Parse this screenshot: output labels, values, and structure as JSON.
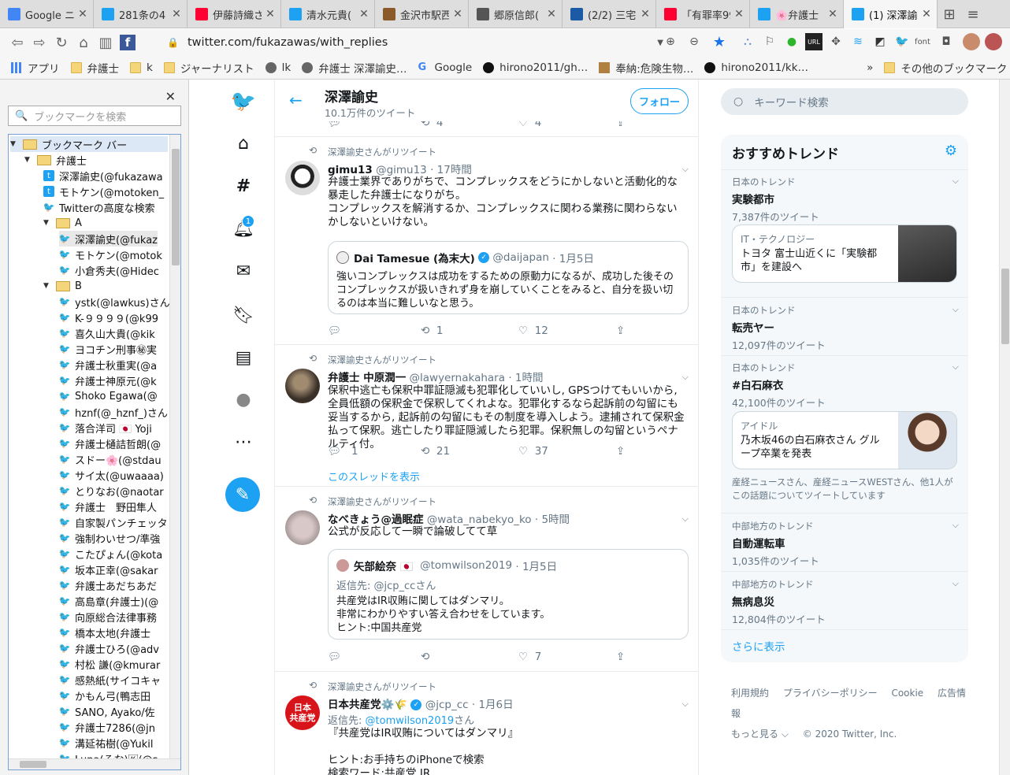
{
  "tabs": [
    {
      "title": "Google ニ",
      "icon": "google-news-icon",
      "color": "#4285f4"
    },
    {
      "title": "281条の4",
      "icon": "twitter-icon",
      "color": "#1da1f2"
    },
    {
      "title": "伊藤詩織さ",
      "icon": "yahoo-icon",
      "color": "#ff0033"
    },
    {
      "title": "清水元貴(",
      "icon": "twitter-icon",
      "color": "#1da1f2"
    },
    {
      "title": "金沢市駅西",
      "icon": "site-icon",
      "color": "#8a5a2b"
    },
    {
      "title": "郷原信郎(",
      "icon": "site-icon",
      "color": "#555555"
    },
    {
      "title": "(2/2) 三宅",
      "icon": "j-icon",
      "color": "#1d5aa6"
    },
    {
      "title": "「有罪率99",
      "icon": "yahoo-icon",
      "color": "#ff0033"
    },
    {
      "title": "🌸弁護士",
      "icon": "twitter-icon",
      "color": "#1da1f2"
    },
    {
      "title": "(1) 深澤諭",
      "icon": "twitter-icon",
      "color": "#1da1f2"
    }
  ],
  "toolbar": {
    "url": "twitter.com/fukazawas/with_replies"
  },
  "bookmarks_bar": [
    "アプリ",
    "弁護士",
    "k",
    "ジャーナリスト",
    "lk",
    "弁護士 深澤諭史…",
    "Google",
    "hirono2011/gh…",
    "奉納:危険生物…",
    "hirono2011/kk…",
    "»",
    "その他のブックマーク"
  ],
  "sidebar": {
    "search_placeholder": "ブックマークを検索",
    "tree": [
      {
        "label": "ブックマーク バー",
        "type": "folder",
        "level": 0,
        "open": true
      },
      {
        "label": "弁護士",
        "type": "folder",
        "level": 1,
        "open": true
      },
      {
        "label": "深澤諭史(@fukazawa",
        "type": "bm",
        "level": 2,
        "icon": "t"
      },
      {
        "label": "モトケン(@motoken_",
        "type": "bm",
        "level": 2,
        "icon": "t"
      },
      {
        "label": "Twitterの高度な検索",
        "type": "bm",
        "level": 2,
        "icon": "tw"
      },
      {
        "label": "A",
        "type": "folder",
        "level": 2,
        "open": true
      },
      {
        "label": "深澤諭史(@fukaz",
        "type": "bm",
        "level": 3,
        "icon": "tw",
        "selected": true
      },
      {
        "label": "モトケン(@motok",
        "type": "bm",
        "level": 3,
        "icon": "tw"
      },
      {
        "label": "小倉秀夫(@Hidec",
        "type": "bm",
        "level": 3,
        "icon": "tw"
      },
      {
        "label": "B",
        "type": "folder",
        "level": 2,
        "open": true
      },
      {
        "label": "ystk(@lawkus)さん",
        "type": "bm",
        "level": 3,
        "icon": "tw"
      },
      {
        "label": "K-９９９９(@k99",
        "type": "bm",
        "level": 3,
        "icon": "tw"
      },
      {
        "label": "喜久山大貴(@kik",
        "type": "bm",
        "level": 3,
        "icon": "tw"
      },
      {
        "label": "ヨコチン刑事㊙実",
        "type": "bm",
        "level": 3,
        "icon": "tw"
      },
      {
        "label": "弁護士秋重実(@a",
        "type": "bm",
        "level": 3,
        "icon": "tw"
      },
      {
        "label": "弁護士神原元(@k",
        "type": "bm",
        "level": 3,
        "icon": "tw"
      },
      {
        "label": "Shoko Egawa(@",
        "type": "bm",
        "level": 3,
        "icon": "tw"
      },
      {
        "label": "hznf(@_hznf_)さん",
        "type": "bm",
        "level": 3,
        "icon": "tw"
      },
      {
        "label": "落合洋司 🇯🇵 Yoji",
        "type": "bm",
        "level": 3,
        "icon": "tw"
      },
      {
        "label": "弁護士樋詰哲朗(@",
        "type": "bm",
        "level": 3,
        "icon": "tw"
      },
      {
        "label": "スドー🌸(@stdau",
        "type": "bm",
        "level": 3,
        "icon": "tw"
      },
      {
        "label": "サイ太(@uwaaaa)",
        "type": "bm",
        "level": 3,
        "icon": "tw"
      },
      {
        "label": "とりなお(@naotar",
        "type": "bm",
        "level": 3,
        "icon": "tw"
      },
      {
        "label": "弁護士　野田隼人",
        "type": "bm",
        "level": 3,
        "icon": "tw"
      },
      {
        "label": "自家製パンチェッタ",
        "type": "bm",
        "level": 3,
        "icon": "tw"
      },
      {
        "label": "強制わいせつ/準強",
        "type": "bm",
        "level": 3,
        "icon": "tw"
      },
      {
        "label": "こたぴょん(@kota",
        "type": "bm",
        "level": 3,
        "icon": "tw"
      },
      {
        "label": "坂本正幸(@sakar",
        "type": "bm",
        "level": 3,
        "icon": "tw"
      },
      {
        "label": "弁護士あだちあだ",
        "type": "bm",
        "level": 3,
        "icon": "tw"
      },
      {
        "label": "高島章(弁護士)(@",
        "type": "bm",
        "level": 3,
        "icon": "tw"
      },
      {
        "label": "向原総合法律事務",
        "type": "bm",
        "level": 3,
        "icon": "tw"
      },
      {
        "label": "橋本太地(弁護士",
        "type": "bm",
        "level": 3,
        "icon": "tw"
      },
      {
        "label": "弁護士ひろ(@adv",
        "type": "bm",
        "level": 3,
        "icon": "tw"
      },
      {
        "label": "村松 謙(@kmurar",
        "type": "bm",
        "level": 3,
        "icon": "tw"
      },
      {
        "label": "感熱紙(サイコキャ",
        "type": "bm",
        "level": 3,
        "icon": "tw"
      },
      {
        "label": "かもん弓(鴨志田",
        "type": "bm",
        "level": 3,
        "icon": "tw"
      },
      {
        "label": "SANO, Ayako/佐",
        "type": "bm",
        "level": 3,
        "icon": "tw"
      },
      {
        "label": "弁護士7286(@jn",
        "type": "bm",
        "level": 3,
        "icon": "tw"
      },
      {
        "label": "溝延祐樹(@Yukil",
        "type": "bm",
        "level": 3,
        "icon": "tw"
      },
      {
        "label": "Luna(るな)🄺(@s",
        "type": "bm",
        "level": 3,
        "icon": "tw"
      }
    ]
  },
  "nav": {
    "notification_count": "1"
  },
  "profile": {
    "name": "深澤諭史",
    "tweet_count": "10.1万件のツイート",
    "follow_label": "フォロー"
  },
  "top_partial": {
    "retweets": "4",
    "likes": "4"
  },
  "tweets": [
    {
      "retweet_label": "深澤諭史さんがリツイート",
      "name": "gimu13",
      "handle": "@gimu13",
      "time": "· 17時間",
      "text": "弁護士業界でありがちで、コンプレックスをどうにかしないと活動化的な暴走した弁護士になりがち。\nコンプレックスを解消するか、コンプレックスに関わる業務に関わらないかしないといけない。",
      "quote": {
        "name": "Dai Tamesue (為末大)",
        "handle": "@daijapan",
        "time": "· 1月5日",
        "text": "強いコンプレックスは成功をするための原動力になるが、成功した後そのコンプレックスが扱いきれず身を崩していくことをみると、自分を扱い切るのは本当に難しいなと思う。"
      },
      "replies": "",
      "retweets": "1",
      "likes": "12"
    },
    {
      "retweet_label": "深澤諭史さんがリツイート",
      "name": "弁護士 中原潤一",
      "handle": "@lawyernakahara",
      "time": "· 1時間",
      "text": "保釈中逃亡も保釈中罪証隠滅も犯罪化していいし, GPSつけてもいいから, 全員低額の保釈金で保釈してくれよな。犯罪化するなら起訴前の勾留にも妥当するから, 起訴前の勾留にもその制度を導入しよう。逮捕されて保釈金払って保釈。逃亡したり罪証隠滅したら犯罪。保釈無しの勾留というペナルティ付。",
      "replies": "1",
      "retweets": "21",
      "likes": "37",
      "thread_label": "このスレッドを表示"
    },
    {
      "retweet_label": "深澤諭史さんがリツイート",
      "name": "なべきょう@過眠症",
      "handle": "@wata_nabekyo_ko",
      "time": "· 5時間",
      "text": "公式が反応して一瞬で論破してて草",
      "quote": {
        "name": "矢部絵奈 🇯🇵",
        "handle": "@tomwilson2019",
        "time": "· 1月5日",
        "reply_to": "返信先: @jcp_ccさん",
        "text": "共産党はIR収賄に関してはダンマリ。\n非常にわかりやすい答え合わせをしています。\nヒント:中国共産党"
      },
      "replies": "",
      "retweets": "",
      "likes": "7"
    },
    {
      "retweet_label": "深澤諭史さんがリツイート",
      "name": "日本共産党⚙️🌾",
      "handle": "@jcp_cc",
      "time": "· 1月6日",
      "reply_to_prefix": "返信先: ",
      "reply_to_handle": "@tomwilson2019",
      "reply_to_suffix": "さん",
      "text": "『共産党はIR収賄についてはダンマリ』\n\nヒント:お手持ちのiPhoneで検索\n検索ワード:共産党 IR"
    }
  ],
  "right": {
    "search_placeholder": "キーワード検索",
    "trends_title": "おすすめトレンド",
    "trends": [
      {
        "category": "日本のトレンド",
        "name": "実験都市",
        "count": "7,387件のツイート"
      },
      {
        "card": true,
        "category": "IT・テクノロジー",
        "text": "トヨタ 富士山近くに「実験都市」を建設へ"
      },
      {
        "category": "日本のトレンド",
        "name": "転売ヤー",
        "count": "12,097件のツイート"
      },
      {
        "category": "日本のトレンド",
        "name": "#白石麻衣",
        "count": "42,100件のツイート"
      },
      {
        "card": true,
        "category": "アイドル",
        "text": "乃木坂46の白石麻衣さん グループ卒業を発表"
      },
      {
        "note": "産経ニュースさん、産経ニュースWESTさん、他1人がこの話題についてツイートしています"
      },
      {
        "category": "中部地方のトレンド",
        "name": "自動運転車",
        "count": "1,035件のツイート"
      },
      {
        "category": "中部地方のトレンド",
        "name": "無病息災",
        "count": "12,804件のツイート"
      }
    ],
    "show_more": "さらに表示",
    "footer": [
      "利用規約",
      "プライバシーポリシー",
      "Cookie",
      "広告情報",
      "もっと見る ⌵",
      "© 2020 Twitter, Inc."
    ]
  }
}
